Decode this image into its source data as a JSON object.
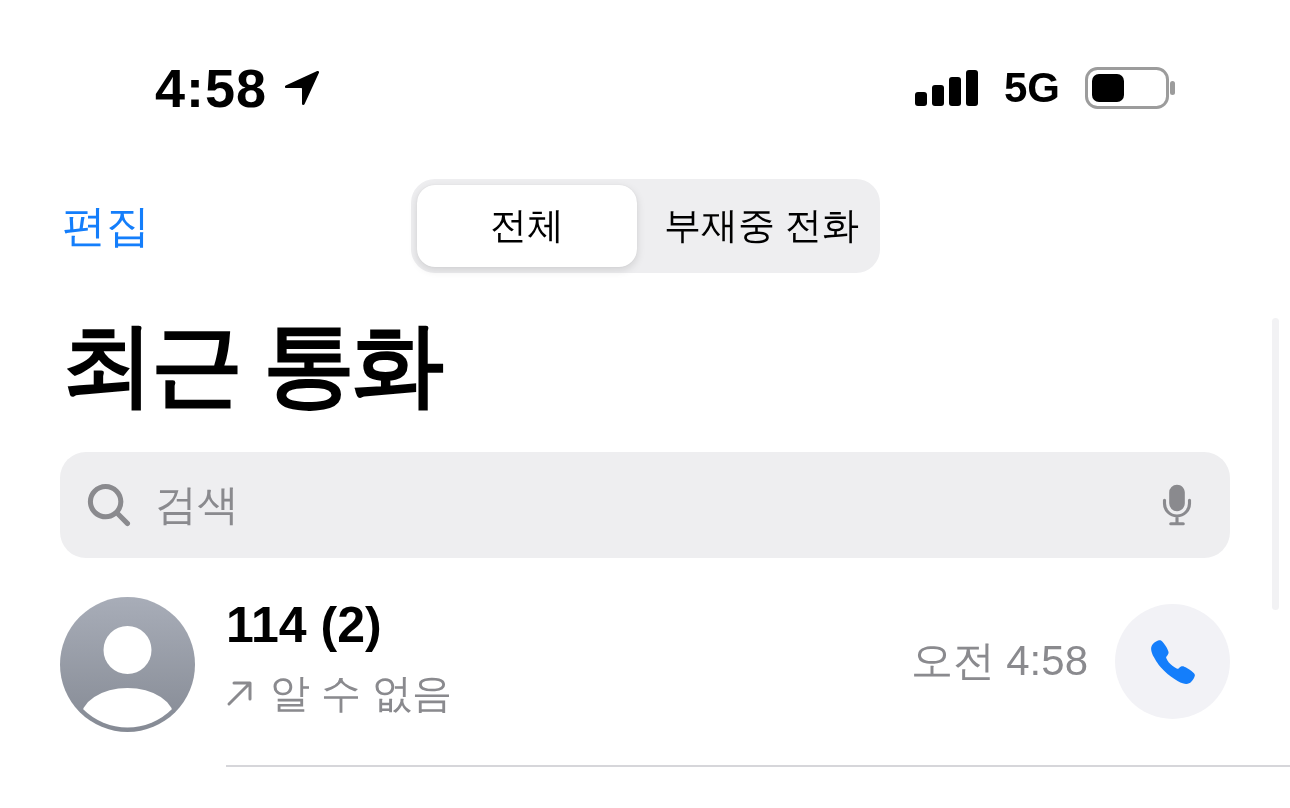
{
  "status_bar": {
    "time": "4:58",
    "network": "5G"
  },
  "nav": {
    "edit_button": "편집",
    "segments": [
      {
        "label": "전체",
        "selected": true
      },
      {
        "label": "부재중 전화",
        "selected": false
      }
    ]
  },
  "title": "최근 통화",
  "search": {
    "placeholder": "검색"
  },
  "calls": [
    {
      "name": "114 (2)",
      "outgoing": true,
      "label": "알 수 없음",
      "time": "오전 4:58"
    }
  ]
}
